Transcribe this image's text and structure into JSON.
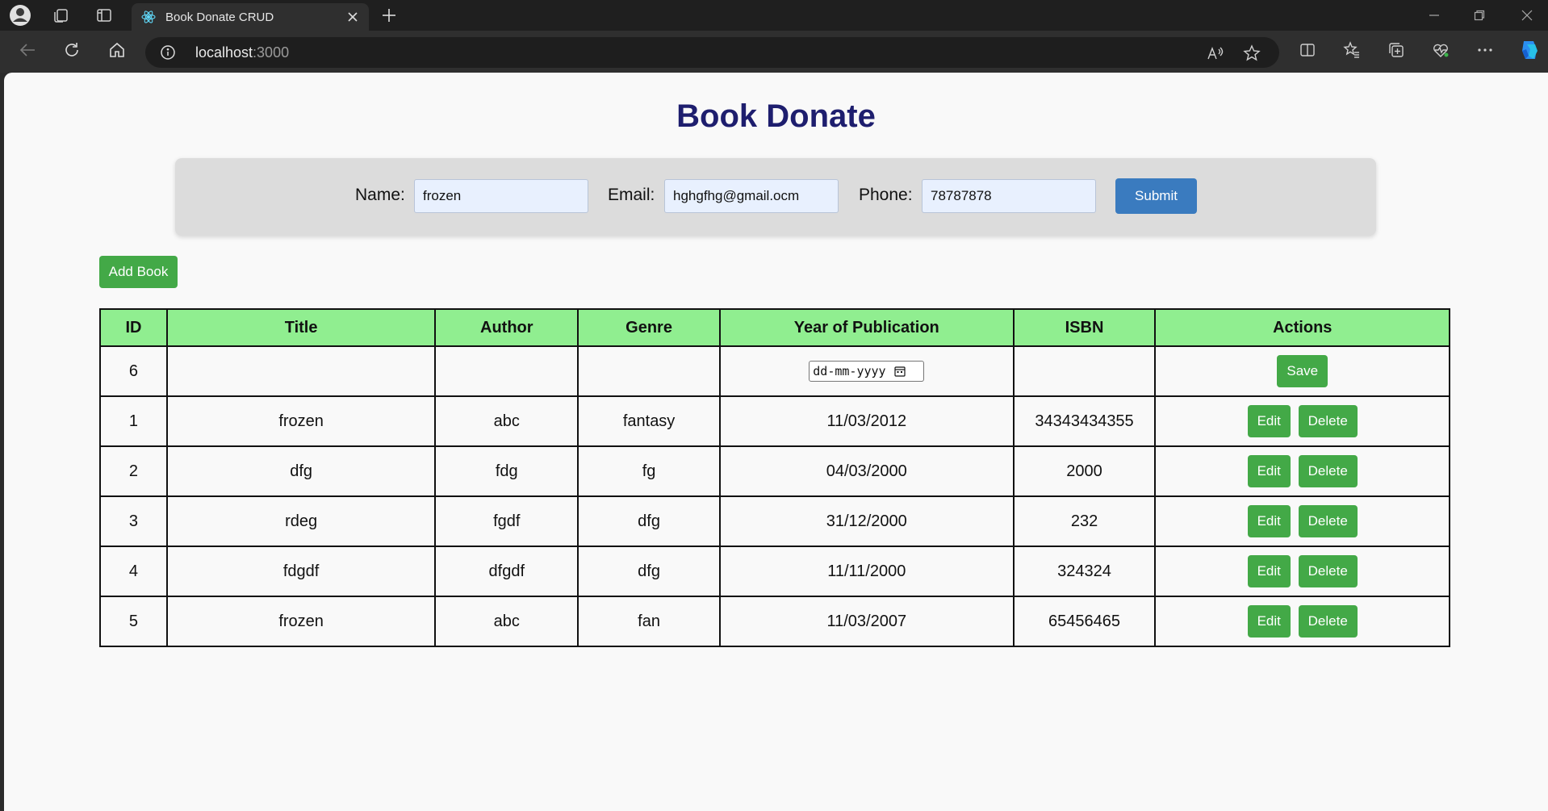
{
  "browser": {
    "tab_title": "Book Donate CRUD",
    "url_host": "localhost",
    "url_port": ":3000"
  },
  "page": {
    "heading": "Book Donate"
  },
  "form": {
    "name_label": "Name:",
    "name_value": "frozen",
    "email_label": "Email:",
    "email_value": "hghgfhg@gmail.ocm",
    "phone_label": "Phone:",
    "phone_value": "78787878",
    "submit_label": "Submit"
  },
  "add_book_label": "Add Book",
  "table": {
    "headers": [
      "ID",
      "Title",
      "Author",
      "Genre",
      "Year of Publication",
      "ISBN",
      "Actions"
    ],
    "new_row": {
      "id": "6",
      "date_placeholder": "dd-mm-yyyy",
      "save_label": "Save"
    },
    "edit_label": "Edit",
    "delete_label": "Delete",
    "rows": [
      {
        "id": "1",
        "title": "frozen",
        "author": "abc",
        "genre": "fantasy",
        "year": "11/03/2012",
        "isbn": "34343434355"
      },
      {
        "id": "2",
        "title": "dfg",
        "author": "fdg",
        "genre": "fg",
        "year": "04/03/2000",
        "isbn": "2000"
      },
      {
        "id": "3",
        "title": "rdeg",
        "author": "fgdf",
        "genre": "dfg",
        "year": "31/12/2000",
        "isbn": "232"
      },
      {
        "id": "4",
        "title": "fdgdf",
        "author": "dfgdf",
        "genre": "dfg",
        "year": "11/11/2000",
        "isbn": "324324"
      },
      {
        "id": "5",
        "title": "frozen",
        "author": "abc",
        "genre": "fan",
        "year": "11/03/2007",
        "isbn": "65456465"
      }
    ]
  },
  "colors": {
    "heading": "#1e1e6e",
    "header_row": "#90ee90",
    "action_button": "#43a947",
    "submit_button": "#3a7bbf"
  },
  "icons": {
    "profile": "profile-icon",
    "workspaces": "workspaces-icon",
    "tab_actions": "tab-actions-icon",
    "favicon": "react-icon",
    "close_tab": "close-icon",
    "new_tab": "plus-icon",
    "back": "back-arrow-icon",
    "refresh": "refresh-icon",
    "home": "home-icon",
    "site_info": "info-icon",
    "read_aloud": "read-aloud-icon",
    "favorite": "star-icon",
    "split_screen": "split-screen-icon",
    "favorites": "favorites-icon",
    "collections": "collections-icon",
    "browser_essentials": "heart-pulse-icon",
    "more": "more-icon",
    "copilot": "copilot-icon",
    "calendar": "calendar-icon"
  }
}
